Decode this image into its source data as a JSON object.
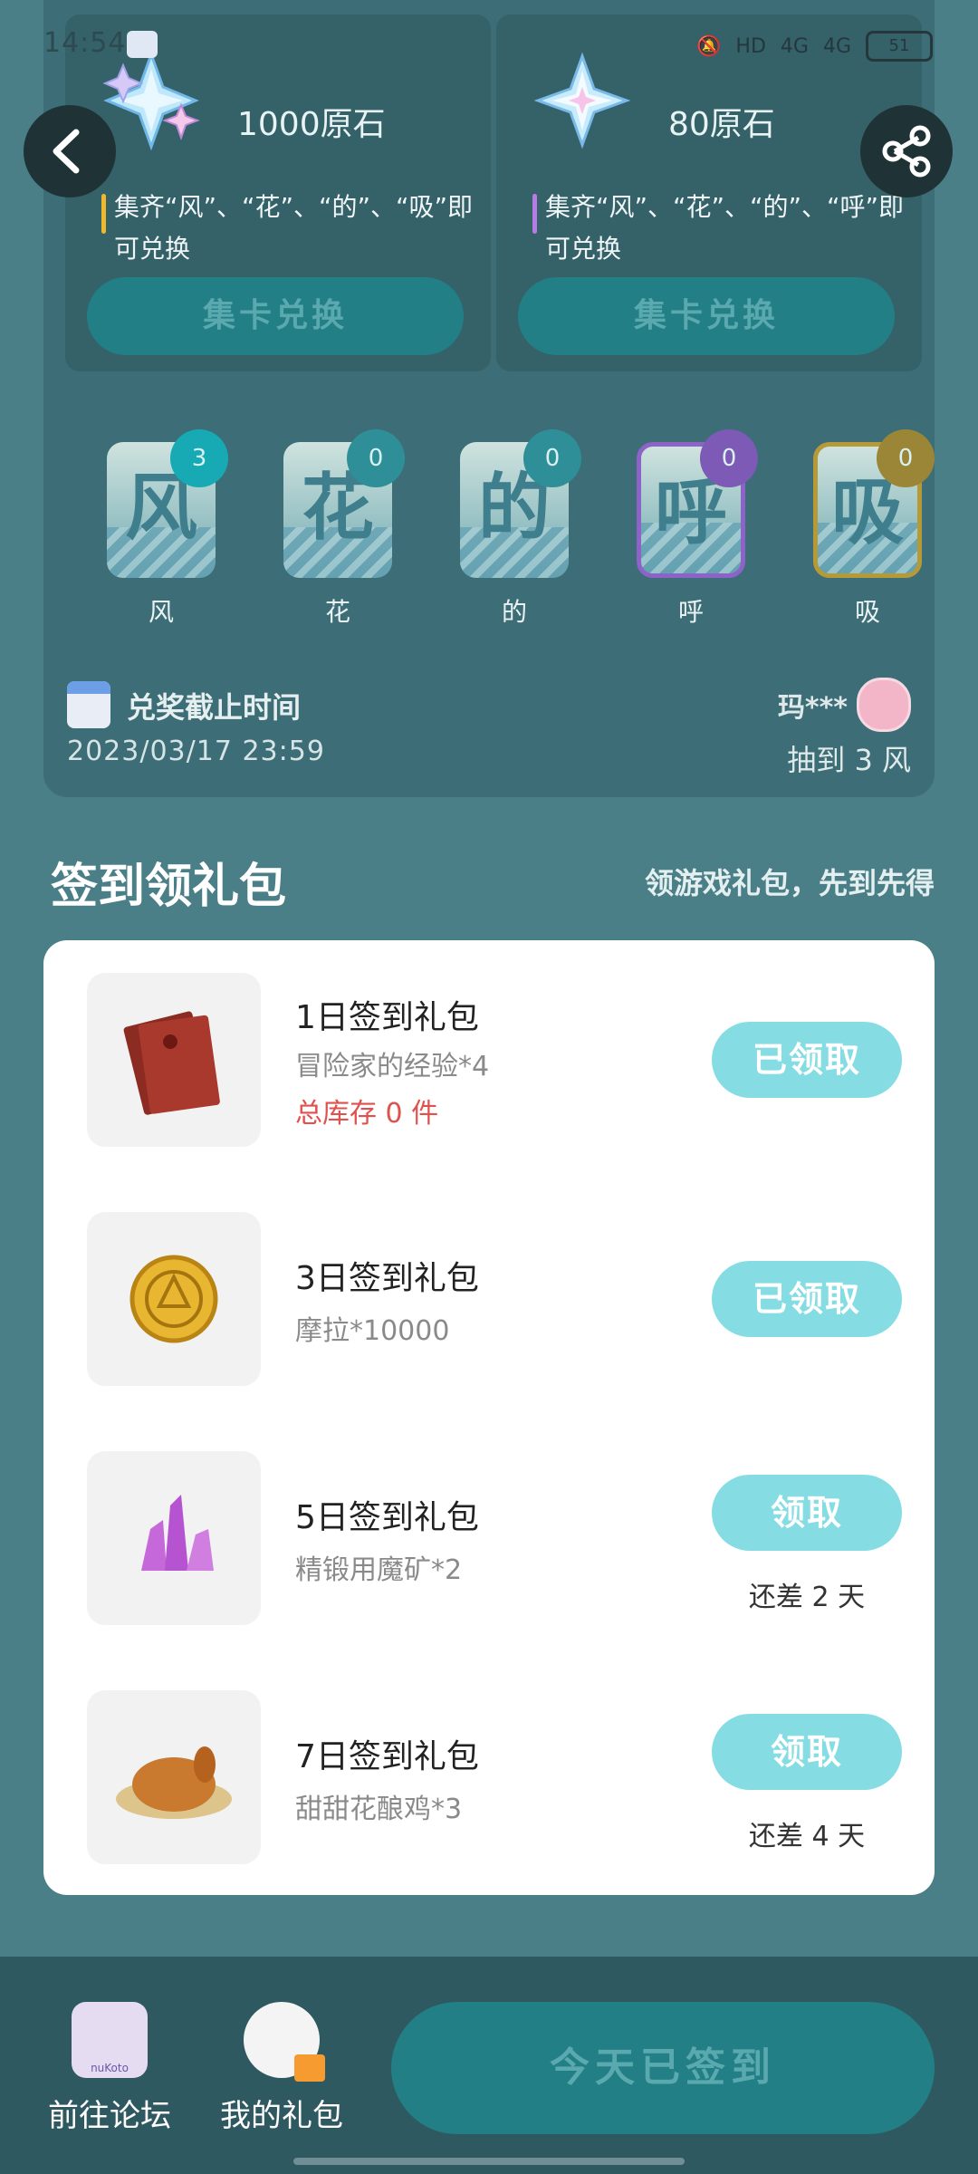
{
  "status_bar": {
    "time": "14:54",
    "signal_1": "4G",
    "signal_2": "4G",
    "hd": "HD",
    "battery": "51"
  },
  "rewards": [
    {
      "title": "1000原石",
      "desc": "集齐“风”、“花”、“的”、“吸”即可兑换",
      "button": "集卡兑换",
      "accent": "#f0b82c"
    },
    {
      "title": "80原石",
      "desc": "集齐“风”、“花”、“的”、“呼”即可兑换",
      "button": "集卡兑换",
      "accent": "#b77be6"
    }
  ],
  "cards": [
    {
      "glyph": "风",
      "name": "风",
      "count": "3",
      "badge_color": "#17aab5"
    },
    {
      "glyph": "花",
      "name": "花",
      "count": "0",
      "badge_color": "#2f8f98"
    },
    {
      "glyph": "的",
      "name": "的",
      "count": "0",
      "badge_color": "#2f8f98"
    },
    {
      "glyph": "呼",
      "name": "呼",
      "count": "0",
      "badge_color": "#7d5ab5"
    },
    {
      "glyph": "吸",
      "name": "吸",
      "count": "0",
      "badge_color": "#9a8636"
    }
  ],
  "deadline": {
    "label": "兑奖截止时间",
    "date": "2023/03/17 23:59"
  },
  "winner": {
    "name": "玛***",
    "msg": "抽到 3 风"
  },
  "checkin": {
    "title": "签到领礼包",
    "subtitle": "领游戏礼包，先到先得",
    "gifts": [
      {
        "name": "1日签到礼包",
        "item": "冒险家的经验*4",
        "stock": "总库存 0 件",
        "button": "已领取",
        "remain": ""
      },
      {
        "name": "3日签到礼包",
        "item": "摩拉*10000",
        "stock": "",
        "button": "已领取",
        "remain": ""
      },
      {
        "name": "5日签到礼包",
        "item": "精锻用魔矿*2",
        "stock": "",
        "button": "领取",
        "remain": "还差 2 天"
      },
      {
        "name": "7日签到礼包",
        "item": "甜甜花酿鸡*3",
        "stock": "",
        "button": "领取",
        "remain": "还差 4 天"
      }
    ]
  },
  "bottom": {
    "forum": "前往论坛",
    "my_gifts": "我的礼包",
    "signed": "今天已签到",
    "avatar_text": "nuKoto"
  },
  "colors": {
    "bg": "#4b7f88",
    "panel": "#3d6d76",
    "claim": "#85dde3",
    "primary_btn": "#237f86"
  },
  "icons": [
    "back-arrow-icon",
    "share-icon",
    "calendar-icon",
    "primogem-icon",
    "gift-box-icon"
  ]
}
